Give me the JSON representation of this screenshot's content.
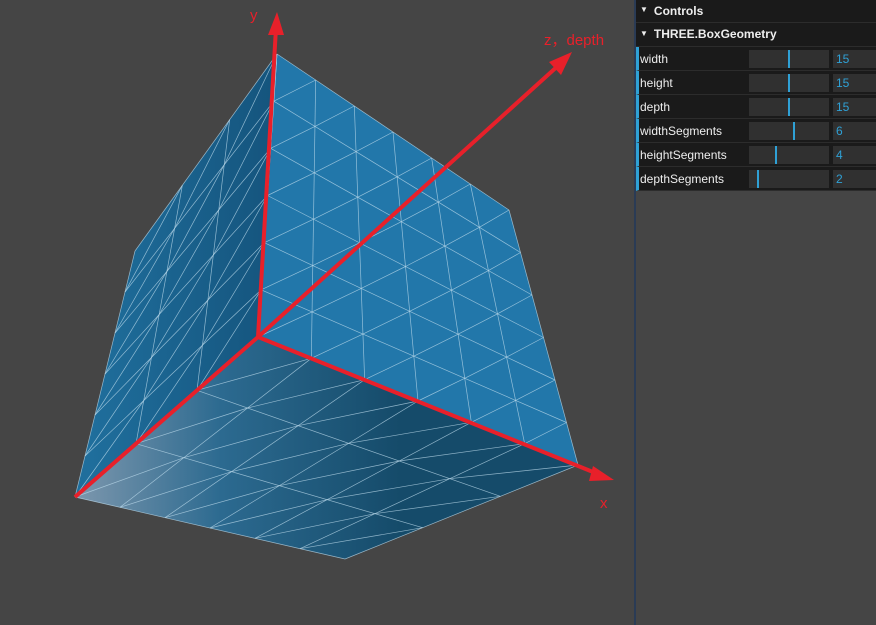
{
  "axes": {
    "x_label": "x",
    "y_label": "y",
    "z_label": "z，depth"
  },
  "gui": {
    "title": "Controls",
    "folder": "THREE.BoxGeometry",
    "controls": [
      {
        "label": "width",
        "value": "15",
        "level": 0.5
      },
      {
        "label": "height",
        "value": "15",
        "level": 0.5
      },
      {
        "label": "depth",
        "value": "15",
        "level": 0.5
      },
      {
        "label": "widthSegments",
        "value": "6",
        "level": 0.56
      },
      {
        "label": "heightSegments",
        "value": "4",
        "level": 0.33
      },
      {
        "label": "depthSegments",
        "value": "2",
        "level": 0.1
      }
    ]
  },
  "colors": {
    "background": "#454545",
    "axis": "#e8202a",
    "cube_front": "#2277aa",
    "cube_left": "#1a5d85",
    "cube_bottom": "#17506f",
    "wire": "#b9d8ea",
    "slider_accent": "#2fa1d6"
  }
}
